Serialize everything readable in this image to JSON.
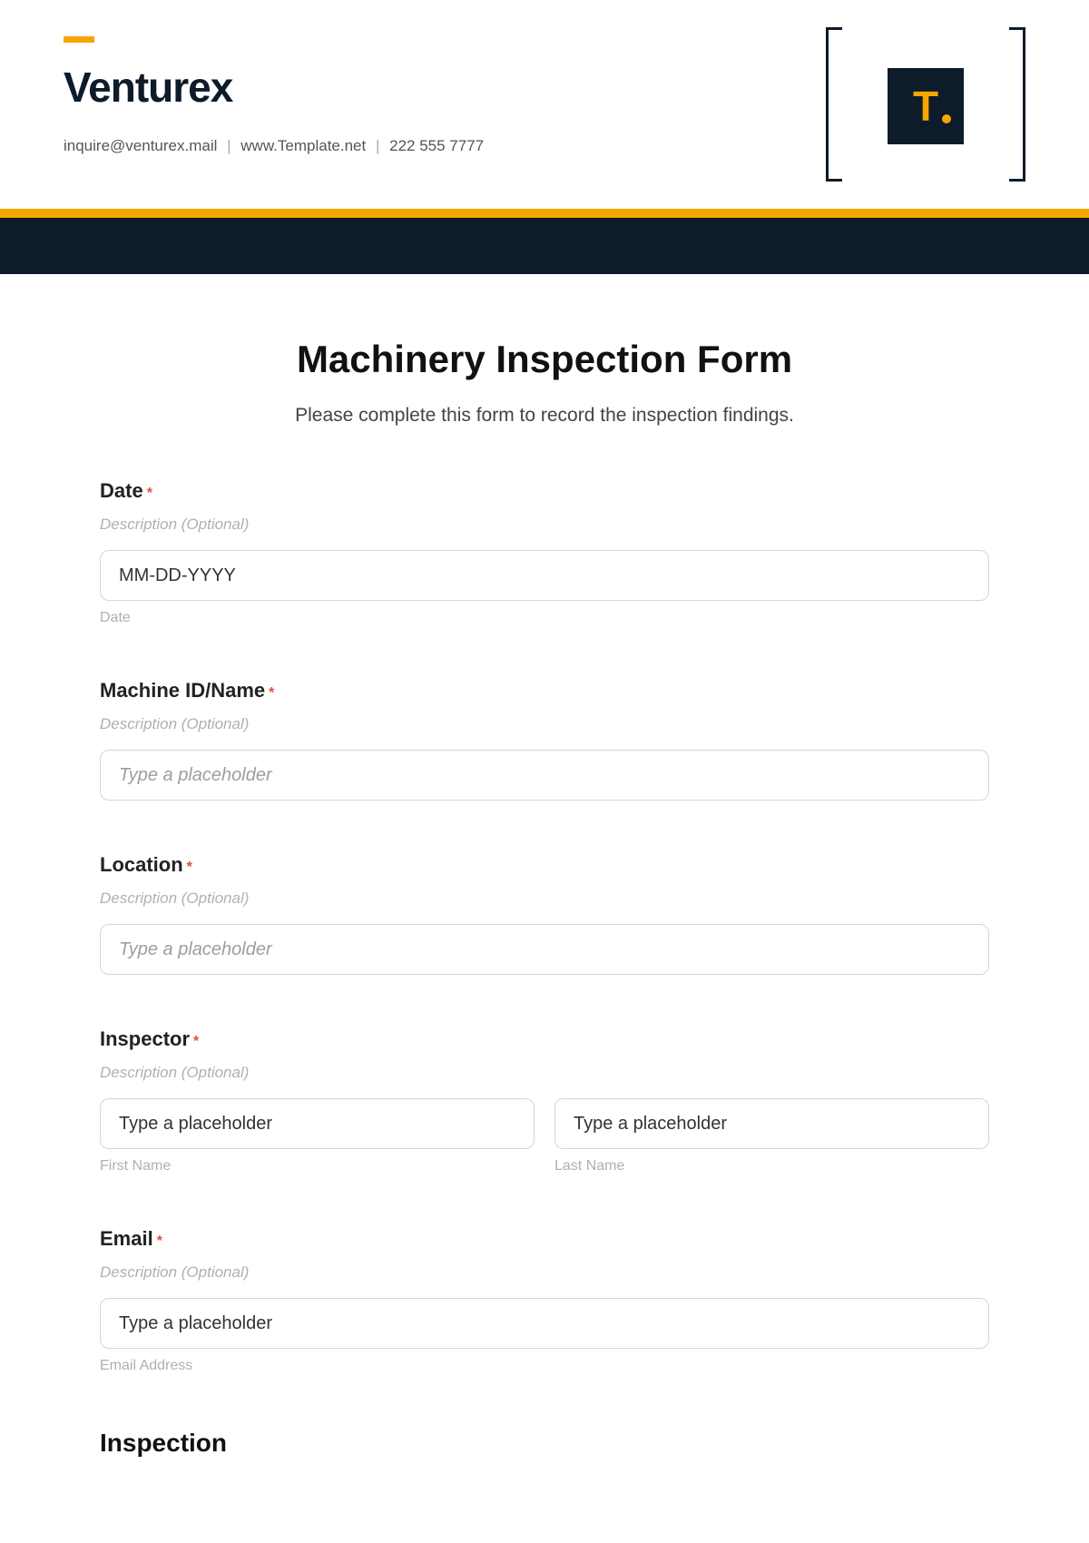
{
  "brand": {
    "name": "Venturex",
    "email": "inquire@venturex.mail",
    "website": "www.Template.net",
    "phone": "222 555 7777",
    "logo_letter": "T."
  },
  "form": {
    "title": "Machinery Inspection Form",
    "subtitle": "Please complete this form to record the inspection findings.",
    "desc_placeholder": "Description (Optional)",
    "generic_placeholder": "Type a placeholder",
    "fields": {
      "date": {
        "label": "Date",
        "placeholder": "MM-DD-YYYY",
        "sublabel": "Date"
      },
      "machine": {
        "label": "Machine ID/Name"
      },
      "location": {
        "label": "Location"
      },
      "inspector": {
        "label": "Inspector",
        "first_sub": "First Name",
        "last_sub": "Last Name"
      },
      "email": {
        "label": "Email",
        "sublabel": "Email Address"
      }
    },
    "section_inspection": "Inspection"
  }
}
